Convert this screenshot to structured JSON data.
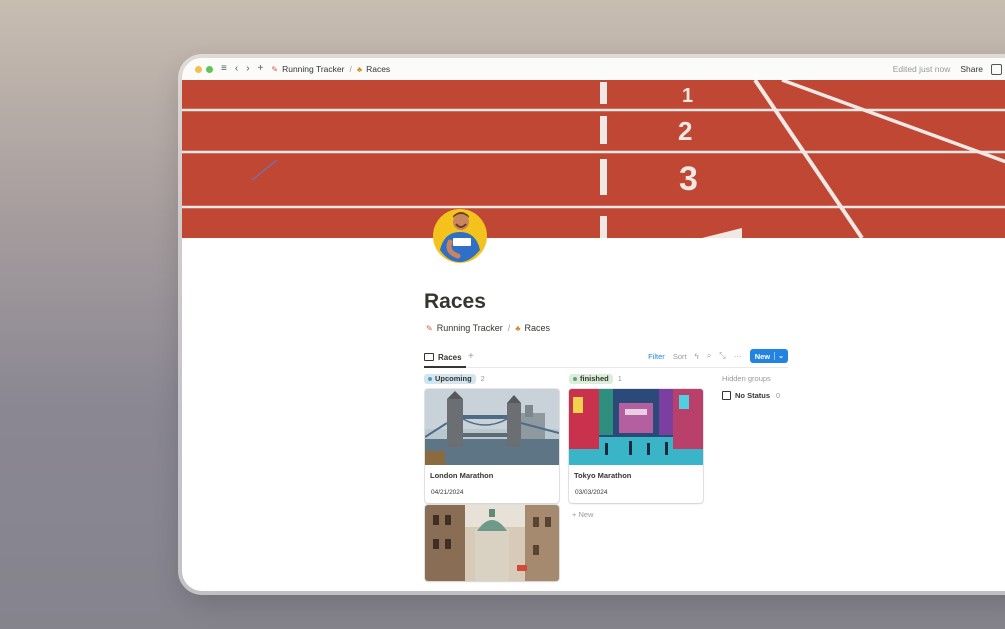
{
  "window": {
    "breadcrumb": [
      {
        "label": "Running Tracker",
        "icon": "pin-icon"
      },
      {
        "label": "Races",
        "icon": "runner-icon"
      }
    ],
    "edited": "Edited just now",
    "share": "Share"
  },
  "cover": {
    "lane_numbers": [
      "1",
      "2",
      "3"
    ]
  },
  "page": {
    "title": "Races",
    "breadcrumb": [
      {
        "label": "Running Tracker"
      },
      {
        "label": "Races"
      }
    ]
  },
  "view": {
    "tab_label": "Races",
    "filter": "Filter",
    "sort": "Sort",
    "new_label": "New"
  },
  "groups": [
    {
      "name": "Upcoming",
      "count": "2",
      "color": "#d3e5ef",
      "dot": "#5b97bd",
      "cards": [
        {
          "title": "London Marathon",
          "date": "04/21/2024"
        },
        {
          "title": "",
          "date": ""
        }
      ]
    },
    {
      "name": "finished",
      "count": "1",
      "color": "#dbeddb",
      "dot": "#6c9b7d",
      "cards": [
        {
          "title": "Tokyo Marathon",
          "date": "03/03/2024"
        }
      ],
      "add_new": "+ New"
    }
  ],
  "hidden_groups": {
    "label": "Hidden groups",
    "items": [
      {
        "name": "No Status",
        "count": "0"
      }
    ]
  },
  "colors": {
    "track": "#c24a36",
    "accent": "#2383e2"
  }
}
